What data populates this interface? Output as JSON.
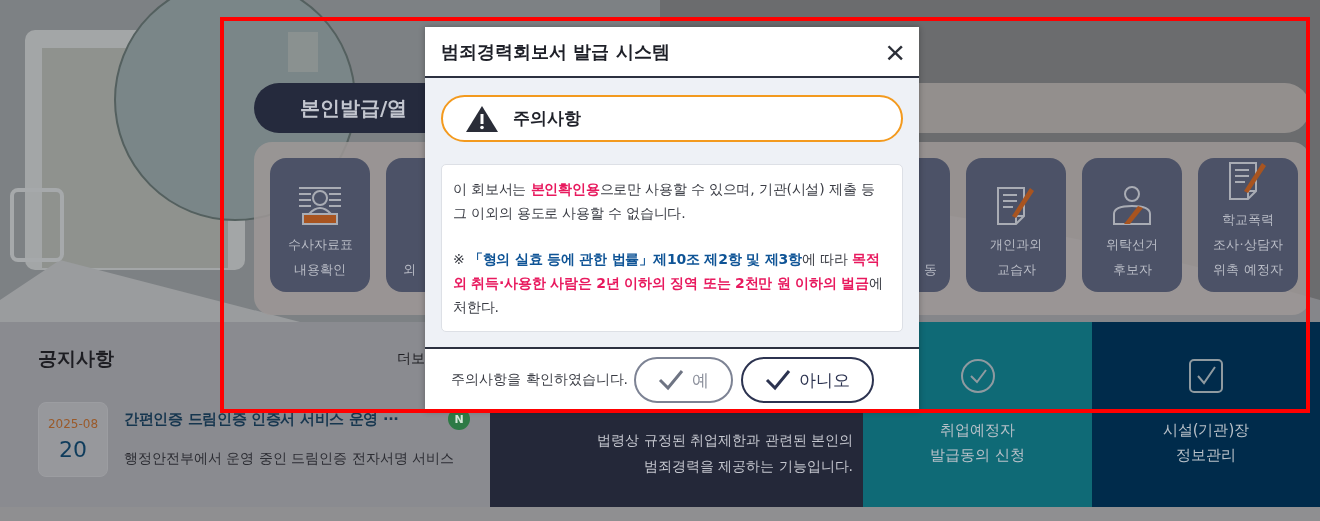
{
  "hero": {
    "kind": "picture",
    "tab_label": "본인발급/열"
  },
  "service_tiles": [
    {
      "lines": [
        "수사자료표",
        "내용확인"
      ],
      "kind": "whole"
    },
    {
      "lines": [
        "외"
      ],
      "kind": "covered-right"
    },
    {
      "lines": [
        "동"
      ],
      "kind": "covered-left"
    },
    {
      "lines": [
        "개인과외",
        "교습자"
      ],
      "kind": "whole"
    },
    {
      "lines": [
        "위탁선거",
        "후보자"
      ],
      "kind": "whole"
    },
    {
      "lines": [
        "학교폭력",
        "조사·상담자",
        "위촉 예정자"
      ],
      "kind": "whole"
    }
  ],
  "notices": {
    "title": "공지사항",
    "more": "더보",
    "items": [
      {
        "month": "2025-08",
        "day": "20",
        "title": "간편인증 드림인증 인증서 서비스 운영 ···",
        "badge": "N",
        "summary": "행정안전부에서 운영 중인 드림인증 전자서명 서비스"
      }
    ]
  },
  "info_panel": {
    "lines": [
      "법령상 규정된 취업제한과 관련된 본인의",
      "범죄경력을 제공하는 기능입니다."
    ]
  },
  "quick_links": [
    {
      "kind": "circle-check",
      "lines": [
        "취업예정자",
        "발급동의 신청"
      ]
    },
    {
      "kind": "square-check",
      "lines": [
        "시설(기관)장",
        "정보관리"
      ]
    }
  ],
  "dialog": {
    "title": "범죄경력회보서 발급 시스템",
    "close": "×",
    "warning": "주의사항",
    "paragraphs": [
      [
        {
          "text": "이 회보서는 "
        },
        {
          "text": "본인확인용",
          "color": "#e8195e"
        },
        {
          "text": "으로만 사용할 수 있으며, 기관(시설) 제출 등 그 이외의 용도로 사용할 수 없습니다."
        }
      ],
      [
        {
          "text": "※ "
        },
        {
          "text": "「형의 실효 등에 관한 법률」제10조 제2항 및 제3항",
          "color": "#0f5496"
        },
        {
          "text": "에 따라 "
        },
        {
          "text": "목적 외 취득·사용한 사람은 2년 이하의 징역 또는 2천만 원 이하의 벌금",
          "color": "#e8195e"
        },
        {
          "text": "에 처한다."
        }
      ]
    ],
    "confirm_text": "주의사항을 확인하였습니다.",
    "buttons": [
      {
        "label": "예",
        "selected": false
      },
      {
        "label": "아니오",
        "selected": true
      }
    ]
  }
}
